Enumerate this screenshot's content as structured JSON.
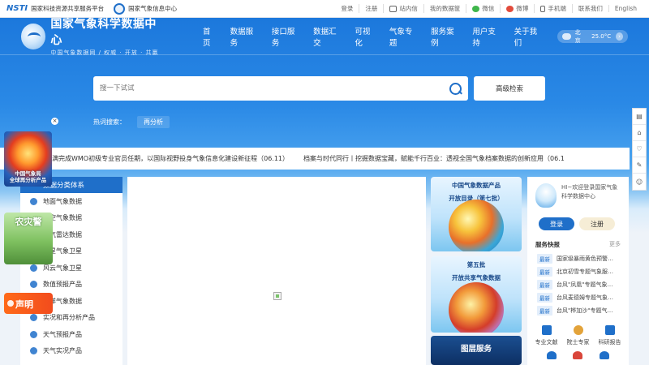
{
  "topbar": {
    "partner1": {
      "logo": "NSTI",
      "text": "国家科技资源共享服务平台"
    },
    "partner2": {
      "text": "国家气象信息中心"
    },
    "links": [
      "登录",
      "注册",
      "站内信",
      "我的数据筐",
      "微信",
      "微博",
      "手机端",
      "联系我们",
      "English"
    ]
  },
  "header": {
    "title": "国家气象科学数据中心",
    "subtitle": "中国气象数据网 / 权威 · 开放 · 共赢",
    "menu": [
      "首页",
      "数据服务",
      "接口服务",
      "数据汇交",
      "可视化",
      "气象专题",
      "服务案例",
      "用户支持",
      "关于我们"
    ],
    "weather": {
      "city": "北京",
      "temp": "25.0°C"
    }
  },
  "search": {
    "placeholder": "搜一下试试",
    "advanced_label": "高级检索",
    "hot_label": "热词搜索：",
    "hot_tags": [
      "再分析"
    ]
  },
  "ticker": {
    "items": [
      "：圆满完成WMO初级专业官员任期，以国际视野投身气象信息化建设新征程（06.11）",
      "档案与时代同行丨挖掘数据宝藏，赋能千行百业：透视全国气象档案数据的创新应用（06.1"
    ]
  },
  "categories": {
    "header": "数据分类体系",
    "items": [
      "地面气象数据",
      "高空气象数据",
      "天气雷达数据",
      "卫星气象卫星",
      "风云气象卫星",
      "数值预报产品",
      "海洋气象数据",
      "实况和再分析产品",
      "天气预报产品",
      "天气实况产品"
    ]
  },
  "cards": {
    "card1": [
      "中国气象数据产品",
      "开放目录（第七批）"
    ],
    "card2": [
      "第五批",
      "开放共享气象数据"
    ],
    "card3": "图层服务"
  },
  "panel": {
    "welcome": "HI~欢迎登录国家气象科学数据中心",
    "login": "登录",
    "register": "注册",
    "quick_title": "服务快报",
    "more": "更多",
    "badge": "最新",
    "news": [
      "国家级暴雨黄色预警…",
      "北京初雪专题气象服…",
      "台风\"凤凰\"专题气象…",
      "台风麦德姆专题气象…",
      "台风\"桦加沙\"专题气…"
    ],
    "quick_links": [
      "专业文献",
      "院士专家",
      "科研报告"
    ]
  },
  "ads": {
    "ad1": [
      "中国气象局",
      "全球再分析产品"
    ],
    "ad2": "农灾警",
    "ad3": "声明"
  },
  "sidetools": [
    "▤",
    "⌂",
    "♡",
    "✎",
    "☺"
  ],
  "colors": {
    "brand_blue": "#1f6fc9",
    "sky_top": "#1c78dc",
    "accent_orange": "#f24c1d"
  }
}
